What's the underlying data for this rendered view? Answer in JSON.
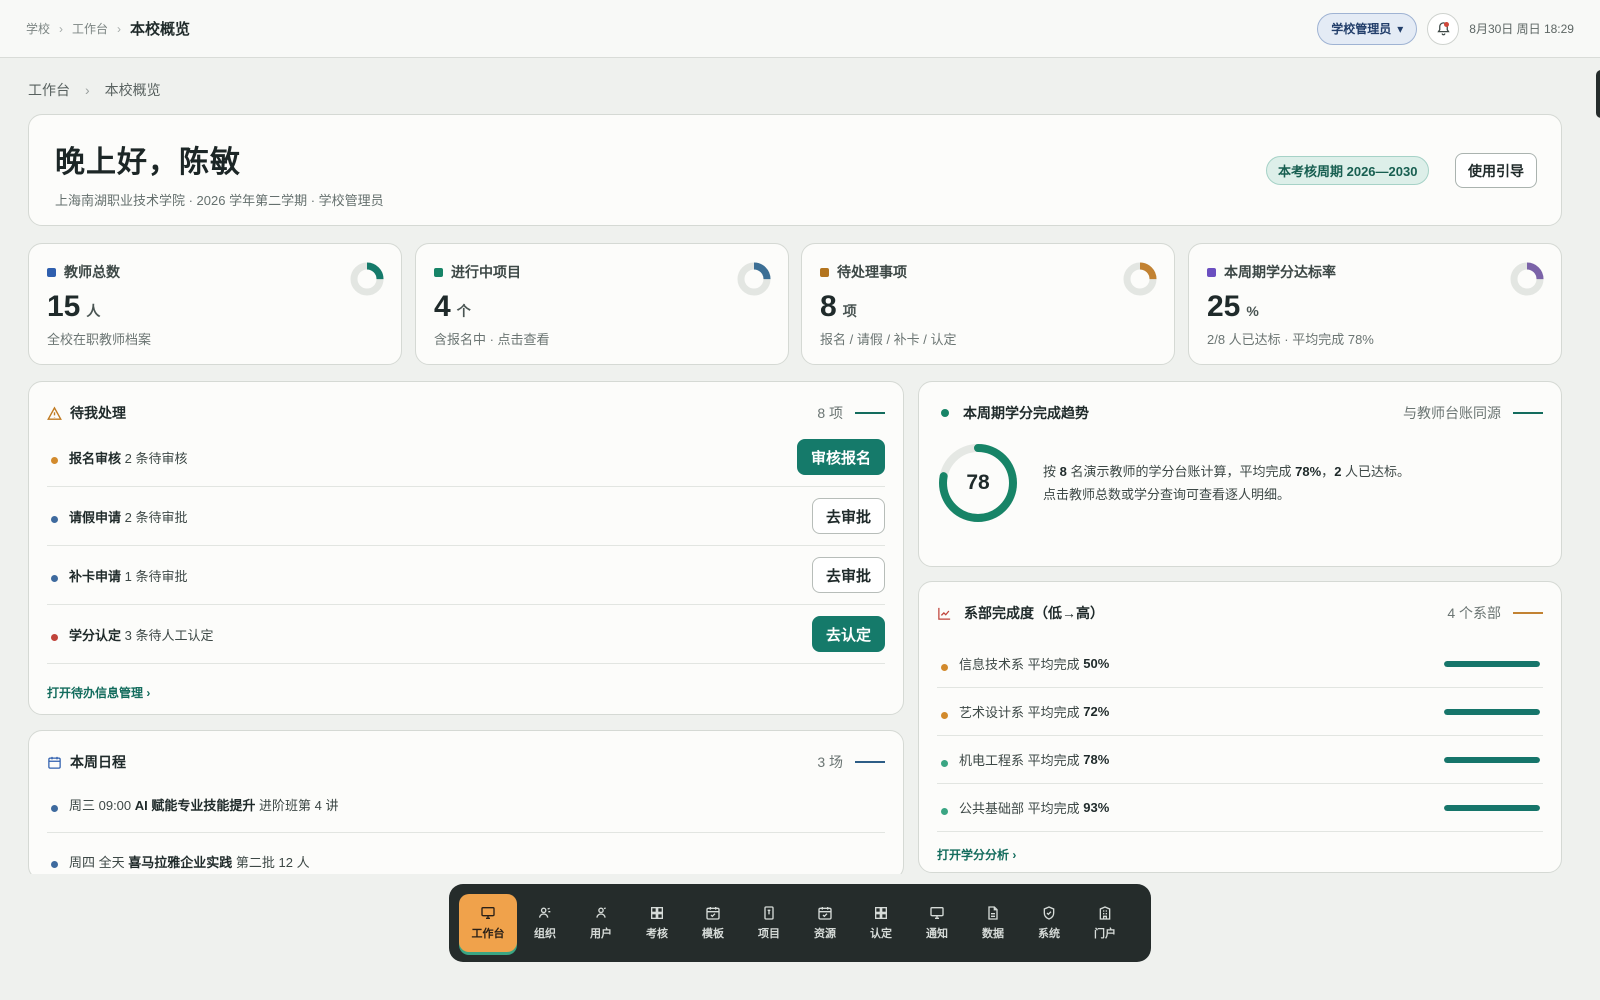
{
  "topbar": {
    "crumbs": [
      "学校",
      "工作台"
    ],
    "crumb_sep": "›",
    "current": "本校概览",
    "role": "学校管理员",
    "role_caret": "▾",
    "datetime": "8月30日 周日 18:29"
  },
  "page_crumb": {
    "items": [
      "工作台",
      "本校概览"
    ],
    "sep": "›"
  },
  "hero": {
    "greeting": "晚上好，陈敏",
    "subtitle": "上海南湖职业技术学院 · 2026 学年第二学期 · 学校管理员",
    "cycle_badge": "本考核周期 2026—2030",
    "guide_button": "使用引导"
  },
  "stats": [
    {
      "label": "教师总数",
      "value": "15",
      "unit": "人",
      "note": "全校在职教师档案",
      "color": "#2f5fae",
      "ring_color": "#157a6a",
      "ring_fraction": 0.25
    },
    {
      "label": "进行中项目",
      "value": "4",
      "unit": "个",
      "note": "含报名中 · 点击查看",
      "color": "#178467",
      "ring_color": "#3c6f95",
      "ring_fraction": 0.25
    },
    {
      "label": "待处理事项",
      "value": "8",
      "unit": "项",
      "note": "报名 / 请假 / 补卡 / 认定",
      "color": "#b3741e",
      "ring_color": "#c28232",
      "ring_fraction": 0.25
    },
    {
      "label": "本周期学分达标率",
      "value": "25",
      "unit": "%",
      "note": "2/8 人已达标 · 平均完成 78%",
      "color": "#6b4fc0",
      "ring_color": "#7b63a8",
      "ring_fraction": 0.25
    }
  ],
  "todo": {
    "title": "待我处理",
    "count": "8 项",
    "items": [
      {
        "name": "报名审核",
        "desc": "2 条待审核",
        "action": "审核报名",
        "dot": "#d28a2c"
      },
      {
        "name": "请假申请",
        "desc": "2 条待审批",
        "action": "去审批",
        "dot": "#3e6a9e"
      },
      {
        "name": "补卡申请",
        "desc": "1 条待审批",
        "action": "去审批",
        "dot": "#3e6a9e"
      },
      {
        "name": "学分认定",
        "desc": "3 条待人工认定",
        "action": "去认定",
        "dot": "#c0433a"
      }
    ],
    "link": "打开待办信息管理 ›"
  },
  "schedule": {
    "title": "本周日程",
    "count": "3 场",
    "items": [
      {
        "time": "周三 09:00",
        "name": "AI 赋能专业技能提升",
        "desc": "进阶班第 4 讲"
      },
      {
        "time": "周四 全天",
        "name": "喜马拉雅企业实践",
        "desc": "第二批 12 人"
      }
    ]
  },
  "trend": {
    "title": "本周期学分完成趋势",
    "source": "与教师台账同源",
    "value": "78",
    "fraction": 0.78,
    "line1_pre": "按",
    "line1_n": "8",
    "line1_mid": "名演示教师的学分台账计算，平均完成",
    "line1_pct": "78%",
    "line1_sep": "，",
    "line1_ok": "2",
    "line1_end": "人已达标。",
    "line2": "点击教师总数或学分查询可查看逐人明细。"
  },
  "depts": {
    "title": "系部完成度（低→高）",
    "count": "4 个系部",
    "items": [
      {
        "name": "信息技术系",
        "label": "平均完成",
        "pct": "50%",
        "fraction": 1.0,
        "dot": "#d28a2c"
      },
      {
        "name": "艺术设计系",
        "label": "平均完成",
        "pct": "72%",
        "fraction": 1.0,
        "dot": "#d28a2c"
      },
      {
        "name": "机电工程系",
        "label": "平均完成",
        "pct": "78%",
        "fraction": 1.0,
        "dot": "#3aa583"
      },
      {
        "name": "公共基础部",
        "label": "平均完成",
        "pct": "93%",
        "fraction": 1.0,
        "dot": "#3aa583"
      }
    ],
    "link": "打开学分分析 ›"
  },
  "dock": {
    "items": [
      {
        "label": "工作台",
        "icon": "monitor-icon"
      },
      {
        "label": "组织",
        "icon": "org-icon"
      },
      {
        "label": "用户",
        "icon": "users-icon"
      },
      {
        "label": "考核",
        "icon": "grid-icon"
      },
      {
        "label": "模板",
        "icon": "calendar-check-icon"
      },
      {
        "label": "项目",
        "icon": "file-icon"
      },
      {
        "label": "资源",
        "icon": "calendar-check-icon"
      },
      {
        "label": "认定",
        "icon": "grid-icon"
      },
      {
        "label": "通知",
        "icon": "monitor-icon"
      },
      {
        "label": "数据",
        "icon": "document-icon"
      },
      {
        "label": "系统",
        "icon": "shield-icon"
      },
      {
        "label": "门户",
        "icon": "building-icon"
      }
    ]
  },
  "colors": {
    "accent": "#157a6a",
    "dock_bg": "#252c2b",
    "dock_active": "#f0a24b"
  }
}
